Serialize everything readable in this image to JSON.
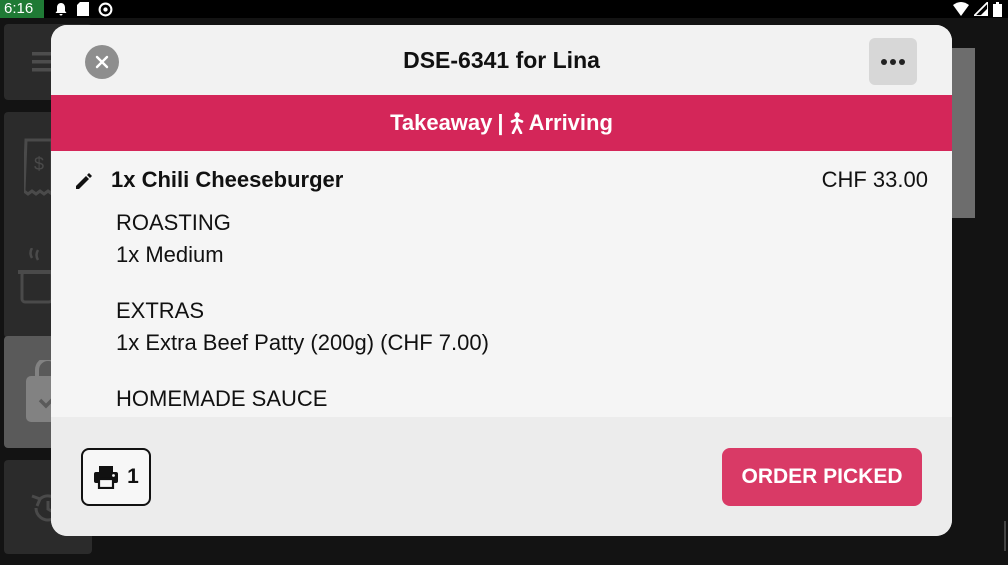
{
  "status_bar": {
    "time": "6:16",
    "left_icons": [
      "notification-bell-icon",
      "sd-card-icon",
      "no-entry-icon"
    ],
    "right_icons": [
      "wifi-icon",
      "signal-icon",
      "battery-icon"
    ]
  },
  "background_app": {
    "sidebar_icons": [
      "menu-icon",
      "receipt-icon",
      "cooking-pot-icon",
      "shopping-bag-icon",
      "history-icon"
    ],
    "active_item": "shopping-bag-icon"
  },
  "modal": {
    "title": "DSE-6341 for Lina",
    "close_icon": "close-icon",
    "more_icon": "more-horizontal-icon",
    "banner": {
      "type": "Takeaway",
      "separator": "|",
      "status": "Arriving",
      "status_icon": "walking-person-icon",
      "color": "#d42659"
    },
    "item": {
      "name": "1x Chili Cheeseburger",
      "price": "CHF 33.00",
      "edit_icon": "pencil-icon",
      "modifiers": [
        {
          "group": "ROASTING",
          "value": "1x Medium"
        },
        {
          "group": "EXTRAS",
          "value": "1x Extra Beef Patty (200g) (CHF 7.00)"
        },
        {
          "group": "HOMEMADE SAUCE",
          "value": ""
        }
      ]
    },
    "footer": {
      "print_icon": "printer-icon",
      "print_count": "1",
      "action_label": "ORDER PICKED",
      "action_color": "#d93a66"
    }
  }
}
